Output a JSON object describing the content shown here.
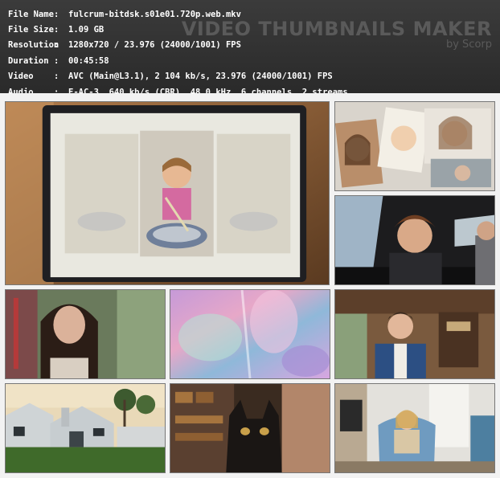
{
  "file_info": [
    {
      "label": "File Name",
      "value": "fulcrum-bitdsk.s01e01.720p.web.mkv"
    },
    {
      "label": "File Size",
      "value": "1.09 GB"
    },
    {
      "label": "Resolution",
      "value": "1280x720 / 23.976 (24000/1001) FPS"
    },
    {
      "label": "Duration",
      "value": "00:45:58"
    },
    {
      "label": "Video",
      "value": "AVC (Main@L3.1), 2 104 kb/s, 23.976 (24000/1001) FPS"
    },
    {
      "label": "Audio",
      "value": "E-AC-3, 640 kb/s (CBR), 48.0 kHz, 6 channels, 2 streams"
    }
  ],
  "separator": ":",
  "watermark": {
    "title": "VIDEO THUMBNAILS MAKER",
    "subtitle": "by Scorp"
  },
  "thumbnails": [
    {
      "scene": "laptop-screen-girl-mixing-bowl"
    },
    {
      "scene": "photo-collage-smiling-girls"
    },
    {
      "scene": "young-man-in-car"
    },
    {
      "scene": "woman-long-dark-hair-interview"
    },
    {
      "scene": "abstract-iridescent-blur"
    },
    {
      "scene": "man-blue-suit-interview"
    },
    {
      "scene": "white-house-exterior-palm-trees"
    },
    {
      "scene": "black-cat-closeup"
    },
    {
      "scene": "woman-blue-armchair-living-room"
    }
  ]
}
